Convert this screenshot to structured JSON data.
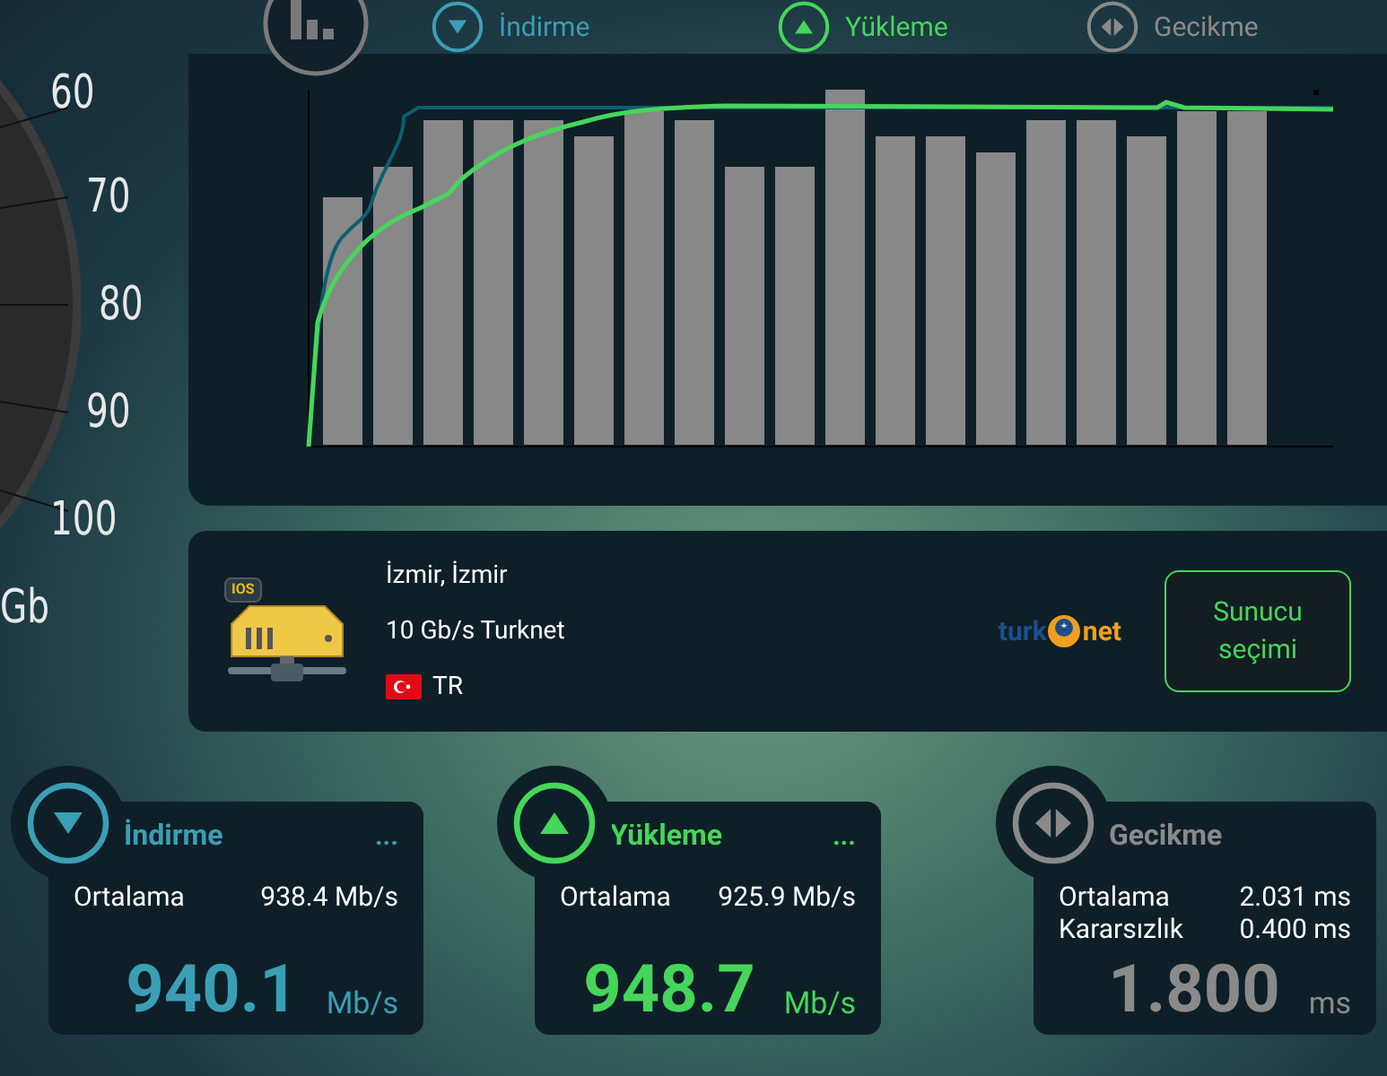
{
  "gauge": {
    "ticks": [
      "60",
      "70",
      "80",
      "90",
      "100"
    ],
    "unit": "Gb"
  },
  "legend": [
    {
      "label": "İndirme",
      "kind": "download",
      "color": "#3a9fb5"
    },
    {
      "label": "Yükleme",
      "kind": "upload",
      "color": "#45d65a"
    },
    {
      "label": "Gecikme",
      "kind": "latency",
      "color": "#8a8a8a"
    }
  ],
  "server": {
    "badge": "IOS",
    "city": "İzmir, İzmir",
    "provider": "10 Gb/s Turknet",
    "country": "TR",
    "logo": {
      "left": "turk",
      "right": "net"
    },
    "button": "Sunucu seçimi"
  },
  "cards": [
    {
      "kind": "download",
      "title": "İndirme",
      "color": "#3a9fb5",
      "menu": "...",
      "rows": [
        {
          "label": "Ortalama",
          "value": "938.4 Mb/s"
        }
      ],
      "value": "940.1",
      "unit": "Mb/s"
    },
    {
      "kind": "upload",
      "title": "Yükleme",
      "color": "#45d65a",
      "menu": "...",
      "rows": [
        {
          "label": "Ortalama",
          "value": "925.9 Mb/s"
        }
      ],
      "value": "948.7",
      "unit": "Mb/s"
    },
    {
      "kind": "latency",
      "title": "Gecikme",
      "color": "#8a8a8a",
      "rows": [
        {
          "label": "Ortalama",
          "value": "2.031 ms"
        },
        {
          "label": "Kararsızlık",
          "value": "0.400 ms"
        }
      ],
      "value": "1.800",
      "unit": "ms"
    }
  ]
}
